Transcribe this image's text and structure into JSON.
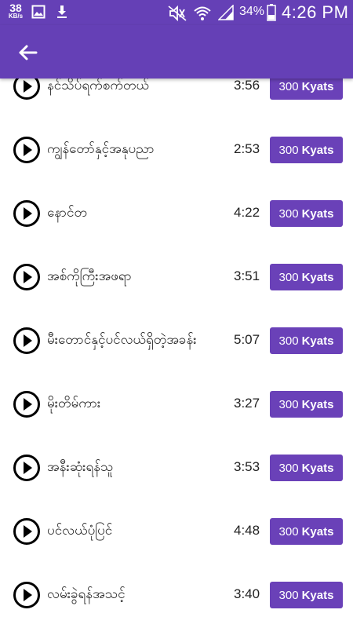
{
  "status_bar": {
    "speed_value": "38",
    "speed_unit": "KB/s",
    "battery_percent": "34%",
    "time": "4:26 PM",
    "icons": [
      "image-icon",
      "download-icon",
      "mute-icon",
      "wifi-icon",
      "signal-icon",
      "battery-icon"
    ]
  },
  "app_bar": {
    "back_icon": "arrow-left-icon"
  },
  "colors": {
    "primary": "#6540b6",
    "button": "#6a41b8",
    "text": "#1a1a1a"
  },
  "tracks": [
    {
      "title": "နင်သိပ်ရက်စက်တယ်",
      "duration": "3:56",
      "price": "300",
      "currency": "Kyats"
    },
    {
      "title": "ကျွန်တော်နှင့်အနုပညာ",
      "duration": "2:53",
      "price": "300",
      "currency": "Kyats"
    },
    {
      "title": "နောင်တ",
      "duration": "4:22",
      "price": "300",
      "currency": "Kyats"
    },
    {
      "title": "အစ်ကိုကြီးအဖရာ",
      "duration": "3:51",
      "price": "300",
      "currency": "Kyats"
    },
    {
      "title": "မီးတောင်နှင့်ပင်လယ်ရှိတဲ့အခန်း",
      "duration": "5:07",
      "price": "300",
      "currency": "Kyats"
    },
    {
      "title": "မိုးတိမ်ကား",
      "duration": "3:27",
      "price": "300",
      "currency": "Kyats"
    },
    {
      "title": "အနီးဆုံးရန်သူ",
      "duration": "3:53",
      "price": "300",
      "currency": "Kyats"
    },
    {
      "title": "ပင်လယ်ပုံပြင်",
      "duration": "4:48",
      "price": "300",
      "currency": "Kyats"
    },
    {
      "title": "လမ်းခွဲရန်အသင့်",
      "duration": "3:40",
      "price": "300",
      "currency": "Kyats"
    }
  ]
}
